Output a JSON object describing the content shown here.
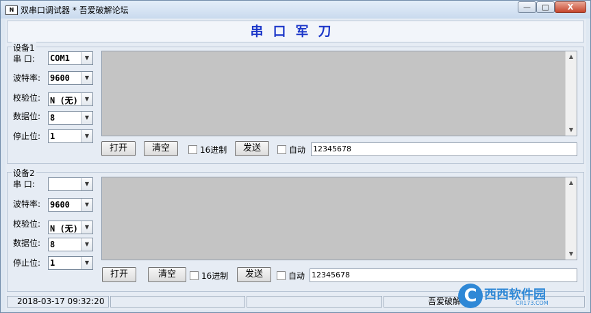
{
  "window": {
    "title": "双串口调试器  * 吾爱破解论坛",
    "app_icon": "N",
    "controls": {
      "minimize": "—",
      "maximize": "□",
      "close": "X"
    }
  },
  "banner": {
    "title": "串口军刀"
  },
  "devices": [
    {
      "group_title": "设备1",
      "fields": {
        "port": {
          "label": "串  口:",
          "value": "COM1"
        },
        "baud": {
          "label": "波特率:",
          "value": "9600"
        },
        "parity": {
          "label": "校验位:",
          "value": "N (无)"
        },
        "databits": {
          "label": "数据位:",
          "value": "8"
        },
        "stopbits": {
          "label": "停止位:",
          "value": "1"
        }
      },
      "open_button": "打开",
      "clear_button": "清空",
      "hex_label": "16进制",
      "send_button": "发送",
      "auto_label": "自动",
      "send_text": "12345678"
    },
    {
      "group_title": "设备2",
      "fields": {
        "port": {
          "label": "串  口:",
          "value": ""
        },
        "baud": {
          "label": "波特率:",
          "value": "9600"
        },
        "parity": {
          "label": "校验位:",
          "value": "N (无)"
        },
        "databits": {
          "label": "数据位:",
          "value": "8"
        },
        "stopbits": {
          "label": "停止位:",
          "value": "1"
        }
      },
      "open_button": "打开",
      "clear_button": "清空",
      "hex_label": "16进制",
      "send_button": "发送",
      "auto_label": "自动",
      "send_text": "12345678"
    }
  ],
  "status": {
    "datetime": "2018-03-17 09:32:20",
    "credit": "吾爱破解"
  },
  "watermark": {
    "glyph": "C",
    "text": "西西软件园",
    "url": "CR173.COM"
  }
}
